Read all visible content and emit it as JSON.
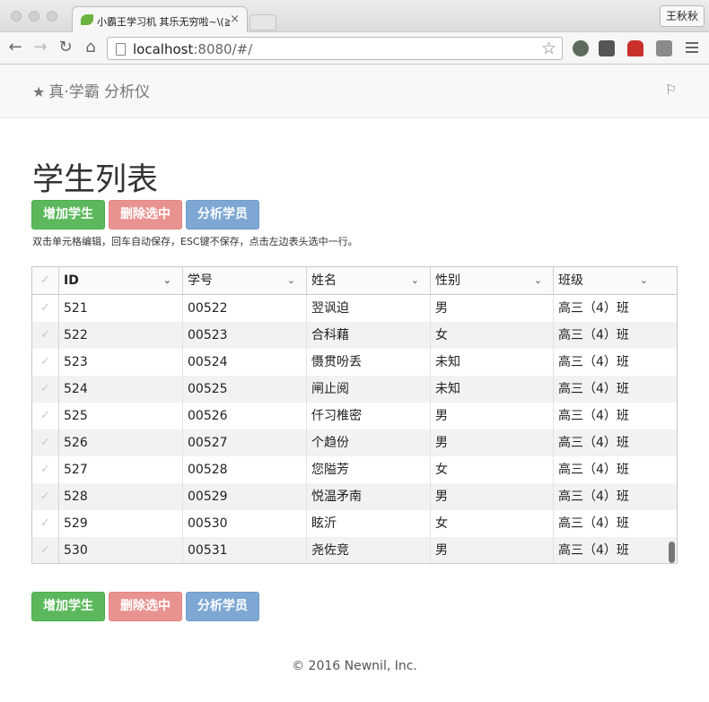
{
  "browser": {
    "tab_title": "小霸王学习机 其乐无穷啦~\\(≧▽",
    "tab_close": "×",
    "user_button": "王秋秋",
    "url_host": "localhost",
    "url_rest": ":8080/#/"
  },
  "navbar": {
    "brand": "真·学霸 分析仪"
  },
  "main": {
    "title": "学生列表",
    "add_label": "增加学生",
    "delete_label": "删除选中",
    "analyze_label": "分析学员",
    "hint": "双击单元格编辑，回车自动保存，ESC键不保存，点击左边表头选中一行。"
  },
  "table": {
    "columns": [
      "ID",
      "学号",
      "姓名",
      "性别",
      "班级"
    ],
    "rows": [
      [
        "521",
        "00522",
        "翌讽迫",
        "男",
        "高三（4）班"
      ],
      [
        "522",
        "00523",
        "合科藉",
        "女",
        "高三（4）班"
      ],
      [
        "523",
        "00524",
        "慑贯吩丢",
        "未知",
        "高三（4）班"
      ],
      [
        "524",
        "00525",
        "闸止阅",
        "未知",
        "高三（4）班"
      ],
      [
        "525",
        "00526",
        "仟习椎密",
        "男",
        "高三（4）班"
      ],
      [
        "526",
        "00527",
        "个趋份",
        "男",
        "高三（4）班"
      ],
      [
        "527",
        "00528",
        "您隘芳",
        "女",
        "高三（4）班"
      ],
      [
        "528",
        "00529",
        "悦温矛南",
        "男",
        "高三（4）班"
      ],
      [
        "529",
        "00530",
        "眩沂",
        "女",
        "高三（4）班"
      ],
      [
        "530",
        "00531",
        "尧佐竞",
        "男",
        "高三（4）班"
      ]
    ]
  },
  "footer": {
    "text": "© 2016 Newnil, Inc."
  },
  "colors": {
    "green": "#5cb85c",
    "red": "#e89390",
    "blue": "#7ea8d3"
  }
}
